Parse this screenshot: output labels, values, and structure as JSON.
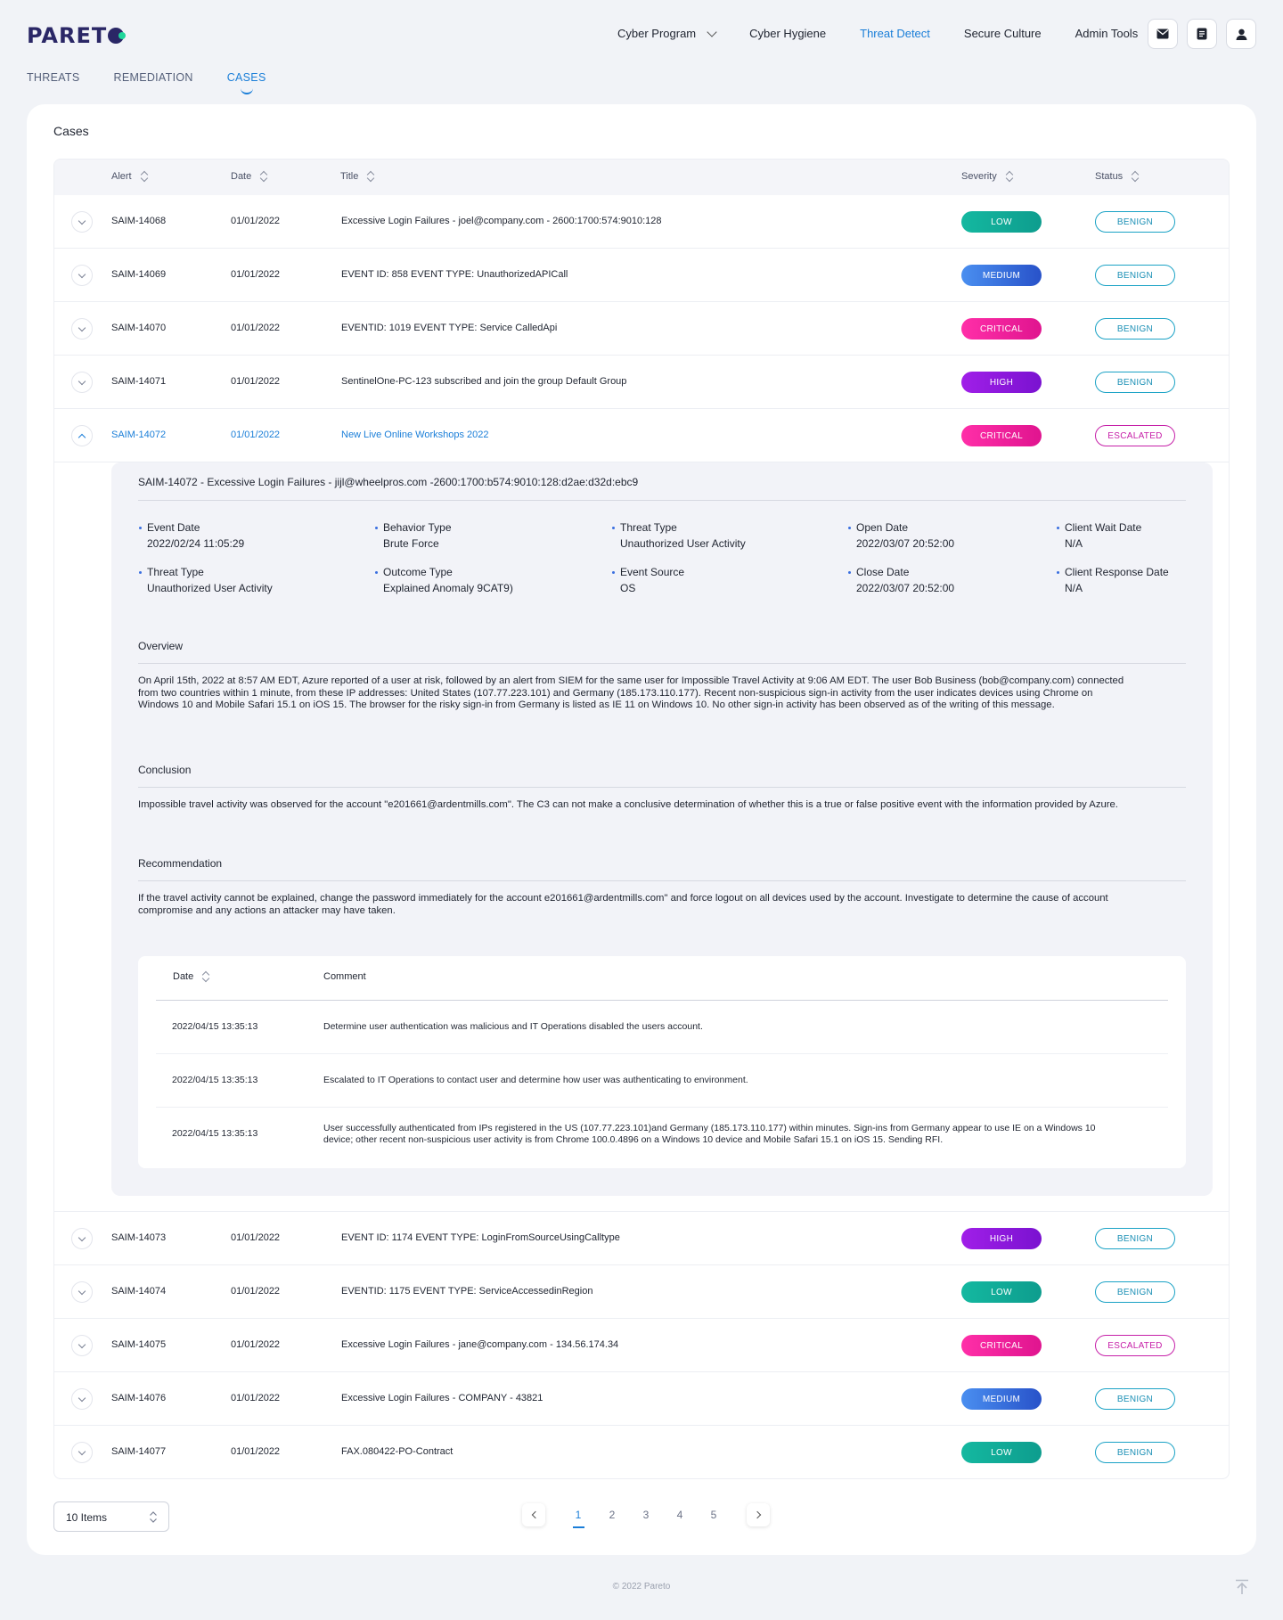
{
  "brand": {
    "logo_text": "PARETO",
    "logo_letters_before": "PARET"
  },
  "main_nav": [
    {
      "label": "Cyber Program",
      "has_dropdown": true,
      "active": false
    },
    {
      "label": "Cyber Hygiene",
      "has_dropdown": false,
      "active": false
    },
    {
      "label": "Threat Detect",
      "has_dropdown": false,
      "active": true
    },
    {
      "label": "Secure Culture",
      "has_dropdown": false,
      "active": false
    },
    {
      "label": "Admin Tools",
      "has_dropdown": true,
      "active": false
    }
  ],
  "header_icons": [
    "mail-icon",
    "document-icon",
    "user-icon"
  ],
  "sub_nav": [
    {
      "label": "THREATS",
      "active": false
    },
    {
      "label": "REMEDIATION",
      "active": false
    },
    {
      "label": "CASES",
      "active": true
    }
  ],
  "cases": {
    "title": "Cases",
    "columns": {
      "alert": "Alert",
      "date": "Date",
      "title": "Title",
      "severity": "Severity",
      "status": "Status"
    },
    "rows_before": [
      {
        "alert": "SAIM-14068",
        "date": "01/01/2022",
        "title": "Excessive Login Failures - joel@company.com - 2600:1700:574:9010:128",
        "severity": "LOW",
        "severity_level": "low",
        "status": "BENIGN",
        "status_type": "benign"
      },
      {
        "alert": "SAIM-14069",
        "date": "01/01/2022",
        "title": "EVENT ID: 858 EVENT TYPE: UnauthorizedAPICall",
        "severity": "MEDIUM",
        "severity_level": "medium",
        "status": "BENIGN",
        "status_type": "benign"
      },
      {
        "alert": "SAIM-14070",
        "date": "01/01/2022",
        "title": "EVENTID: 1019 EVENT TYPE: Service CalledApi",
        "severity": "CRITICAL",
        "severity_level": "critical",
        "status": "BENIGN",
        "status_type": "benign"
      },
      {
        "alert": "SAIM-14071",
        "date": "01/01/2022",
        "title": "SentinelOne-PC-123 subscribed and join the group Default Group",
        "severity": "HIGH",
        "severity_level": "high",
        "status": "BENIGN",
        "status_type": "benign"
      }
    ],
    "open_row": {
      "alert": "SAIM-14072",
      "date": "01/01/2022",
      "title": "New Live Online Workshops 2022",
      "severity": "CRITICAL",
      "severity_level": "critical",
      "status": "ESCALATED",
      "status_type": "escalated"
    },
    "rows_after": [
      {
        "alert": "SAIM-14073",
        "date": "01/01/2022",
        "title": "EVENT ID: 1174 EVENT TYPE: LoginFromSourceUsingCalltype",
        "severity": "HIGH",
        "severity_level": "high",
        "status": "BENIGN",
        "status_type": "benign"
      },
      {
        "alert": "SAIM-14074",
        "date": "01/01/2022",
        "title": "EVENTID: 1175 EVENT TYPE: ServiceAccessedinRegion",
        "severity": "LOW",
        "severity_level": "low",
        "status": "BENIGN",
        "status_type": "benign"
      },
      {
        "alert": "SAIM-14075",
        "date": "01/01/2022",
        "title": "Excessive Login Failures - jane@company.com - 134.56.174.34",
        "severity": "CRITICAL",
        "severity_level": "critical",
        "status": "ESCALATED",
        "status_type": "escalated"
      },
      {
        "alert": "SAIM-14076",
        "date": "01/01/2022",
        "title": "Excessive Login Failures - COMPANY - 43821",
        "severity": "MEDIUM",
        "severity_level": "medium",
        "status": "BENIGN",
        "status_type": "benign"
      },
      {
        "alert": "SAIM-14077",
        "date": "01/01/2022",
        "title": "FAX.080422-PO-Contract",
        "severity": "LOW",
        "severity_level": "low",
        "status": "BENIGN",
        "status_type": "benign"
      }
    ]
  },
  "detail": {
    "heading": "SAIM-14072 - Excessive Login Failures - jijl@wheelpros.com -2600:1700:b574:9010:128:d2ae:d32d:ebc9",
    "fields": [
      {
        "label": "Event Date",
        "value": "2022/02/24  11:05:29"
      },
      {
        "label": "Behavior Type",
        "value": "Brute Force"
      },
      {
        "label": "Threat Type",
        "value": "Unauthorized User Activity"
      },
      {
        "label": "Open Date",
        "value": "2022/03/07  20:52:00"
      },
      {
        "label": "Client Wait Date",
        "value": "N/A"
      },
      {
        "label": "Threat Type",
        "value": "Unauthorized User Activity"
      },
      {
        "label": "Outcome Type",
        "value": "Explained Anomaly 9CAT9)"
      },
      {
        "label": "Event Source",
        "value": "OS"
      },
      {
        "label": "Close Date",
        "value": "2022/03/07  20:52:00"
      },
      {
        "label": "Client Response Date",
        "value": "N/A"
      }
    ],
    "overview_title": "Overview",
    "overview_text": "On April 15th, 2022 at 8:57 AM EDT, Azure reported of a user at risk, followed by an alert from SIEM for the same user for Impossible Travel Activity at 9:06 AM EDT. The user Bob Business (bob@company.com) connected from two countries within 1 minute, from these IP addresses: United States (107.77.223.101) and Germany (185.173.110.177). Recent non-suspicious sign-in activity from the user indicates devices using Chrome on Windows 10 and Mobile Safari 15.1 on iOS 15. The browser for the risky sign-in from Germany is listed as IE 11 on Windows 10. No other sign-in activity has been observed as of the writing of this message.",
    "conclusion_title": "Conclusion",
    "conclusion_text": "Impossible travel activity was observed for the account \"e201661@ardentmills.com\". The C3 can not make a conclusive determination of whether this is a true or false positive event with the information provided by Azure.",
    "recommendation_title": "Recommendation",
    "recommendation_text": "If the travel activity cannot be explained, change the password immediately for the account e201661@ardentmills.com\" and force logout on all devices used by the account. Investigate to determine the cause of account compromise and any actions an attacker may have taken.",
    "comments_columns": {
      "date": "Date",
      "comment": "Comment"
    },
    "comments": [
      {
        "date": "2022/04/15  13:35:13",
        "text": "Determine user authentication was malicious and IT Operations disabled the users account."
      },
      {
        "date": "2022/04/15  13:35:13",
        "text": "Escalated to IT Operations to contact user and determine how user was authenticating to environment."
      },
      {
        "date": "2022/04/15  13:35:13",
        "text": "User successfully authenticated from IPs registered in the US (107.77.223.101)and Germany (185.173.110.177) within minutes. Sign-ins from Germany appear to use IE on a Windows 10 device; other recent non-suspicious user activity is from Chrome 100.0.4896 on a Windows 10 device and Mobile Safari 15.1 on iOS 15. Sending RFI."
      }
    ]
  },
  "pagination": {
    "page_size_label": "10 Items",
    "pages": [
      "1",
      "2",
      "3",
      "4",
      "5"
    ],
    "current_page": "1"
  },
  "footer": {
    "copyright": "© 2022 Pareto"
  },
  "colors": {
    "accent": "#1a7ed8",
    "brand": "#2a2766",
    "brand_dot": "#1fd69a",
    "low": "#0e9d8e",
    "medium": "#2852c9",
    "critical": "#e0148f",
    "high": "#7a12d0",
    "escalated": "#c620a8"
  }
}
